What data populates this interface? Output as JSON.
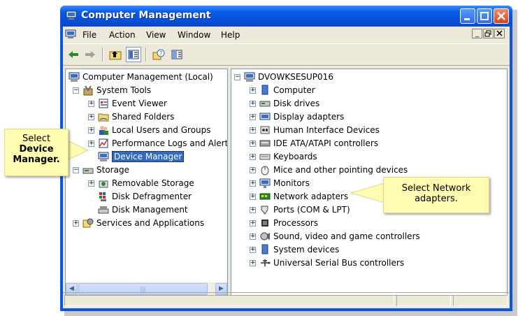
{
  "window": {
    "title": "Computer Management"
  },
  "menu": [
    "File",
    "Action",
    "View",
    "Window",
    "Help"
  ],
  "toolbar": [
    "back-icon",
    "forward-icon",
    "up-icon",
    "show-hide-tree-icon",
    "help-icon",
    "properties-icon"
  ],
  "left_tree": {
    "root": "Computer Management (Local)",
    "system_tools": "System Tools",
    "event_viewer": "Event Viewer",
    "shared_folders": "Shared Folders",
    "local_users": "Local Users and Groups",
    "perf_logs": "Performance Logs and Alert:",
    "device_manager": "Device Manager",
    "storage": "Storage",
    "removable": "Removable Storage",
    "defrag": "Disk Defragmenter",
    "disk_mgmt": "Disk Management",
    "services": "Services and Applications",
    "scroll_thumb_glyph": "|||"
  },
  "right_tree": {
    "computer_name": "DVOWKSESUP016",
    "items": [
      "Computer",
      "Disk drives",
      "Display adapters",
      "Human Interface Devices",
      "IDE ATA/ATAPI controllers",
      "Keyboards",
      "Mice and other pointing devices",
      "Monitors",
      "Network adapters",
      "Ports (COM & LPT)",
      "Processors",
      "Sound, video and game controllers",
      "System devices",
      "Universal Serial Bus controllers"
    ]
  },
  "callouts": {
    "left": {
      "line1": "Select",
      "line2": "Device",
      "line3": "Manager."
    },
    "right": {
      "line1": "Select Network",
      "line2": "adapters."
    }
  }
}
